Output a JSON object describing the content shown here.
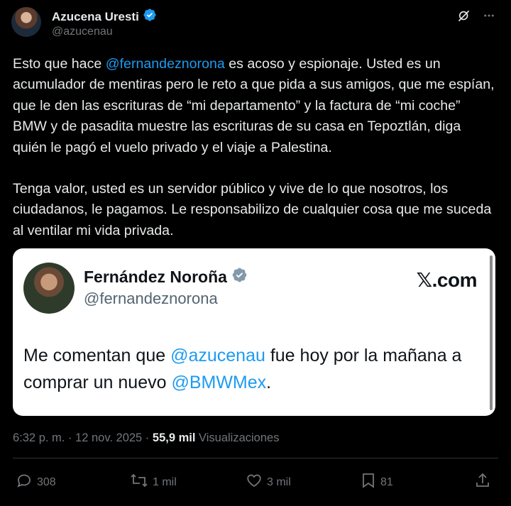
{
  "author": {
    "name": "Azucena Uresti",
    "handle": "@azucenau"
  },
  "tweet": {
    "p1_a": "Esto que hace ",
    "p1_mention": "@fernandeznorona",
    "p1_b": " es acoso y espionaje. Usted es un acumulador de mentiras pero le reto a que pida a sus amigos, que me espían, que le den las escrituras de “mi departamento”  y la factura de “mi coche” BMW y de pasadita muestre las escrituras de su casa en Tepoztlán, diga quién le pagó el vuelo privado y el viaje a Palestina.",
    "p2": "Tenga valor, usted es un servidor público y vive de lo que nosotros, los ciudadanos, le pagamos. Le responsabilizo de cualquier cosa que me suceda al ventilar mi vida privada."
  },
  "quoted": {
    "name": "Fernández Noroña",
    "handle": "@fernandeznorona",
    "site": "𝕏.com",
    "text_a": "Me comentan que ",
    "mention1": "@azucenau",
    "text_b": " fue hoy por la mañana a comprar un nuevo ",
    "mention2": "@BMWMex",
    "text_c": "."
  },
  "meta": {
    "time": "6:32 p. m. · 12 nov. 2025 · ",
    "views_count": "55,9 mil",
    "views_label": " Visualizaciones"
  },
  "actions": {
    "replies": "308",
    "reposts": "1 mil",
    "likes": "3 mil",
    "bookmarks": "81"
  },
  "icons": {
    "verified": "verified-badge-icon",
    "grok": "grok-icon",
    "more": "more-icon",
    "reply": "reply-icon",
    "repost": "repost-icon",
    "like": "heart-icon",
    "bookmark": "bookmark-icon",
    "share": "share-icon"
  },
  "colors": {
    "link": "#1d9bf0",
    "verified_blue": "#1d9bf0",
    "verified_gray": "#829aab",
    "background": "#000000"
  }
}
